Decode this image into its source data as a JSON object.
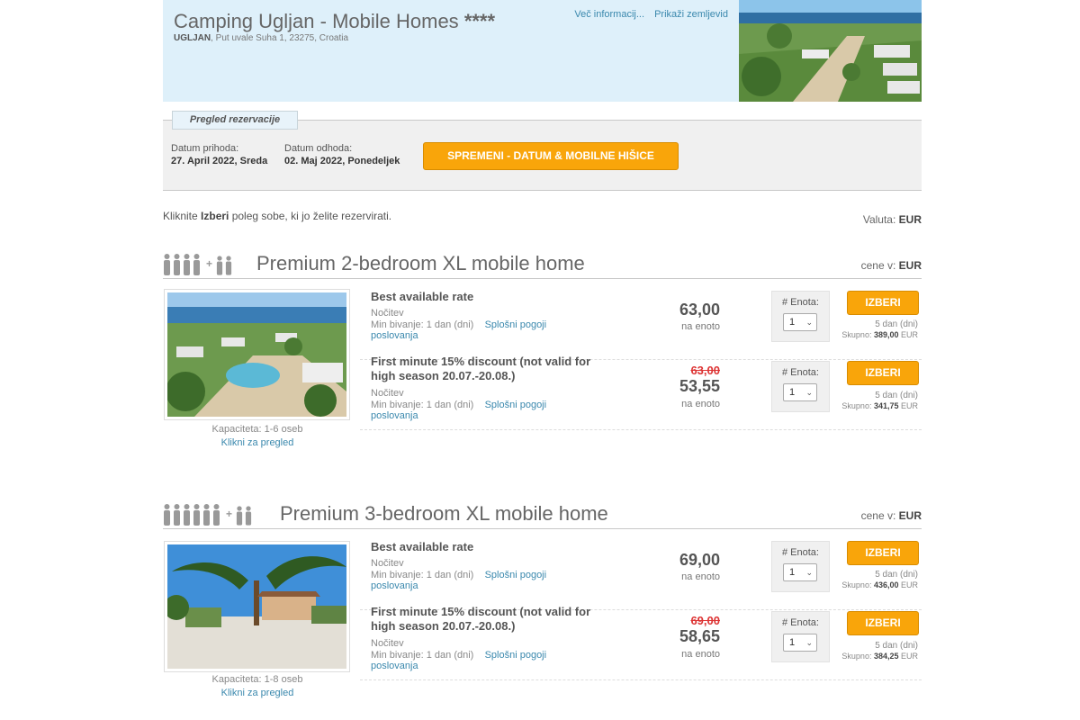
{
  "header": {
    "title": "Camping Ugljan - Mobile Homes",
    "stars": "****",
    "city": "UGLJAN",
    "address": ", Put uvale Suha 1, 23275, Croatia",
    "link_more": "Več informacij...",
    "link_map": "Prikaži zemljevid"
  },
  "review": {
    "tab_label": "Pregled rezervacije",
    "arrival_label": "Datum prihoda:",
    "arrival_value": "27. April 2022, Sreda",
    "departure_label": "Datum odhoda:",
    "departure_value": "02. Maj 2022, Ponedeljek",
    "change_button": "SPREMENI - DATUM & MOBILNE HIŠICE"
  },
  "instructions": {
    "prefix": "Kliknite ",
    "bold": "Izberi",
    "suffix": " poleg sobe, ki jo želite rezervirati."
  },
  "currency": {
    "label": "Valuta: ",
    "value": "EUR"
  },
  "rooms": [
    {
      "title": "Premium 2-bedroom XL mobile home",
      "prices_label": "cene v: ",
      "prices_currency": "EUR",
      "capacity": "Kapaciteta: 1-6 oseb",
      "preview_link": "Klikni za pregled",
      "rates": [
        {
          "name": "Best available rate",
          "meal": "Nočitev",
          "min_stay": "Min bivanje: 1 dan (dni)",
          "terms_a": "Splošni pogoji",
          "terms_b": "poslovanja",
          "old_price": "",
          "price": "63,00",
          "unit": "na enoto",
          "qty_label": "# Enota:",
          "qty_value": "1",
          "button": "IZBERI",
          "days": "5 dan (dni)",
          "total_label": "Skupno: ",
          "total_value": "389,00",
          "total_currency": " EUR"
        },
        {
          "name": "First minute 15% discount (not valid for high season 20.07.-20.08.)",
          "meal": "Nočitev",
          "min_stay": "Min bivanje: 1 dan (dni)",
          "terms_a": "Splošni pogoji",
          "terms_b": "poslovanja",
          "old_price": "63,00",
          "price": "53,55",
          "unit": "na enoto",
          "qty_label": "# Enota:",
          "qty_value": "1",
          "button": "IZBERI",
          "days": "5 dan (dni)",
          "total_label": "Skupno: ",
          "total_value": "341,75",
          "total_currency": " EUR"
        }
      ]
    },
    {
      "title": "Premium 3-bedroom XL mobile home",
      "prices_label": "cene v: ",
      "prices_currency": "EUR",
      "capacity": "Kapaciteta: 1-8 oseb",
      "preview_link": "Klikni za pregled",
      "rates": [
        {
          "name": "Best available rate",
          "meal": "Nočitev",
          "min_stay": "Min bivanje: 1 dan (dni)",
          "terms_a": "Splošni pogoji",
          "terms_b": "poslovanja",
          "old_price": "",
          "price": "69,00",
          "unit": "na enoto",
          "qty_label": "# Enota:",
          "qty_value": "1",
          "button": "IZBERI",
          "days": "5 dan (dni)",
          "total_label": "Skupno: ",
          "total_value": "436,00",
          "total_currency": " EUR"
        },
        {
          "name": "First minute 15% discount (not valid for high season 20.07.-20.08.)",
          "meal": "Nočitev",
          "min_stay": "Min bivanje: 1 dan (dni)",
          "terms_a": "Splošni pogoji",
          "terms_b": "poslovanja",
          "old_price": "69,00",
          "price": "58,65",
          "unit": "na enoto",
          "qty_label": "# Enota:",
          "qty_value": "1",
          "button": "IZBERI",
          "days": "5 dan (dni)",
          "total_label": "Skupno: ",
          "total_value": "384,25",
          "total_currency": " EUR"
        }
      ]
    }
  ],
  "colors": {
    "accent_orange": "#f9a50a",
    "link_blue": "#3a88ad",
    "header_bg": "#def0fa",
    "strike_red": "#dd3333"
  },
  "icons": [
    "person-icon",
    "person-small-icon",
    "chevron-down-icon"
  ]
}
